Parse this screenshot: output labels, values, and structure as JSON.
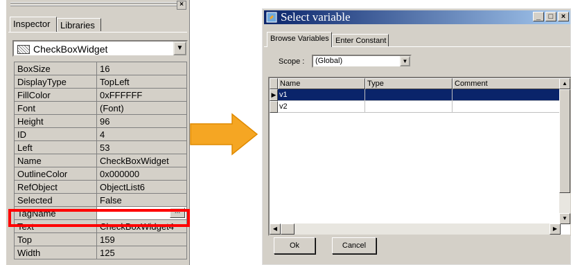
{
  "inspector": {
    "tabs": [
      "Inspector",
      "Libraries"
    ],
    "widget_combo": "CheckBoxWidget",
    "ellipsis_label": "...",
    "properties": [
      {
        "name": "BoxSize",
        "value": "16"
      },
      {
        "name": "DisplayType",
        "value": "TopLeft"
      },
      {
        "name": "FillColor",
        "value": "0xFFFFFF"
      },
      {
        "name": "Font",
        "value": "(Font)"
      },
      {
        "name": "Height",
        "value": "96"
      },
      {
        "name": "ID",
        "value": "4"
      },
      {
        "name": "Left",
        "value": "53"
      },
      {
        "name": "Name",
        "value": "CheckBoxWidget"
      },
      {
        "name": "OutlineColor",
        "value": "0x000000"
      },
      {
        "name": "RefObject",
        "value": "ObjectList6"
      },
      {
        "name": "Selected",
        "value": "False"
      },
      {
        "name": "TagName",
        "value": ""
      },
      {
        "name": "Text",
        "value": "CheckBoxWidget4"
      },
      {
        "name": "Top",
        "value": "159"
      },
      {
        "name": "Width",
        "value": "125"
      }
    ],
    "highlight_color": "#ff0000"
  },
  "arrow": {
    "color": "#f5a623"
  },
  "dialog": {
    "title": "Select variable",
    "title_buttons": [
      "_",
      "□",
      "×"
    ],
    "tabs": [
      "Browse Variables",
      "Enter Constant"
    ],
    "scope_label": "Scope :",
    "scope_value": "(Global)",
    "columns": [
      "Name",
      "Type",
      "Comment"
    ],
    "rows": [
      {
        "name": "v1",
        "type": "",
        "comment": "",
        "selected": true
      },
      {
        "name": "v2",
        "type": "",
        "comment": "",
        "selected": false
      }
    ],
    "ok_label": "Ok",
    "cancel_label": "Cancel",
    "selection_color": "#0a246a"
  }
}
